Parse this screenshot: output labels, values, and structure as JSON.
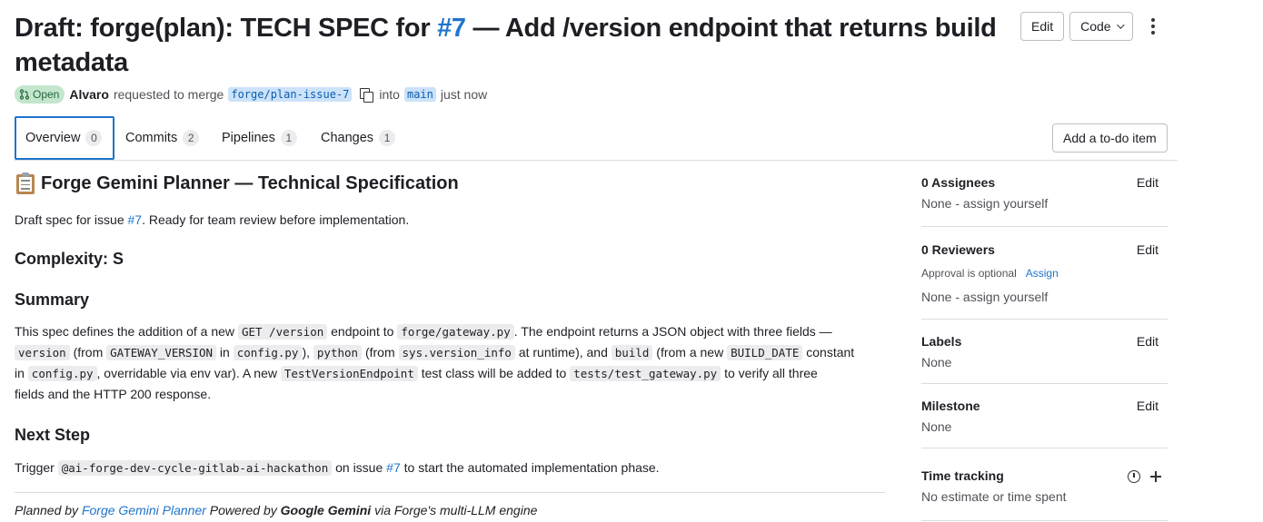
{
  "header": {
    "title_prefix": "Draft: forge(plan): TECH SPEC for ",
    "title_issue": "#7",
    "title_suffix": " — Add /version endpoint that returns build metadata",
    "edit_label": "Edit",
    "code_label": "Code"
  },
  "meta": {
    "status": "Open",
    "author": "Alvaro",
    "requested_text": "requested to merge",
    "source_branch": "forge/plan-issue-7",
    "into_text": "into",
    "target_branch": "main",
    "time": "just now"
  },
  "tabs": [
    {
      "label": "Overview",
      "count": "0"
    },
    {
      "label": "Commits",
      "count": "2"
    },
    {
      "label": "Pipelines",
      "count": "1"
    },
    {
      "label": "Changes",
      "count": "1"
    }
  ],
  "todo_label": "Add a to-do item",
  "description": {
    "heading": "Forge Gemini Planner — Technical Specification",
    "intro_a": "Draft spec for issue ",
    "intro_link": "#7",
    "intro_b": ". Ready for team review before implementation.",
    "complexity": "Complexity: S",
    "summary_heading": "Summary",
    "summary": {
      "t1": "This spec defines the addition of a new ",
      "c1": "GET /version",
      "t2": " endpoint to ",
      "c2": "forge/gateway.py",
      "t3": ". The endpoint returns a JSON object with three fields —",
      "c3": "version",
      "t4": " (from ",
      "c4": "GATEWAY_VERSION",
      "t5": " in ",
      "c5": "config.py",
      "t6": "), ",
      "c6": "python",
      "t7": " (from ",
      "c7": "sys.version_info",
      "t8": " at runtime), and ",
      "c8": "build",
      "t9": " (from a new ",
      "c9": "BUILD_DATE",
      "t10": " constant",
      "t11": "in ",
      "c10": "config.py",
      "t12": ", overridable via env var). A new ",
      "c11": "TestVersionEndpoint",
      "t13": " test class will be added to ",
      "c12": "tests/test_gateway.py",
      "t14": " to verify all three",
      "t15": "fields and the HTTP 200 response."
    },
    "next_heading": "Next Step",
    "next": {
      "t1": "Trigger ",
      "c1": "@ai-forge-dev-cycle-gitlab-ai-hackathon",
      "t2": " on issue ",
      "link": "#7",
      "t3": " to start the automated implementation phase."
    },
    "footer": {
      "t1": "Planned by ",
      "link": "Forge Gemini Planner",
      "t2": " Powered by ",
      "bold": "Google Gemini",
      "t3": " via Forge's multi-LLM engine"
    }
  },
  "sidebar": {
    "assignees_title": "0 Assignees",
    "assignees_value": "None - assign yourself",
    "reviewers_title": "0 Reviewers",
    "reviewers_approval": "Approval is optional",
    "reviewers_assign": "Assign",
    "reviewers_value": "None - assign yourself",
    "labels_title": "Labels",
    "labels_value": "None",
    "milestone_title": "Milestone",
    "milestone_value": "None",
    "time_title": "Time tracking",
    "time_value": "No estimate or time spent",
    "edit_label": "Edit"
  },
  "colors": {
    "link": "#1f75cb",
    "open_badge_bg": "#c3e6cd",
    "branch_bg": "#cbe2f9"
  }
}
